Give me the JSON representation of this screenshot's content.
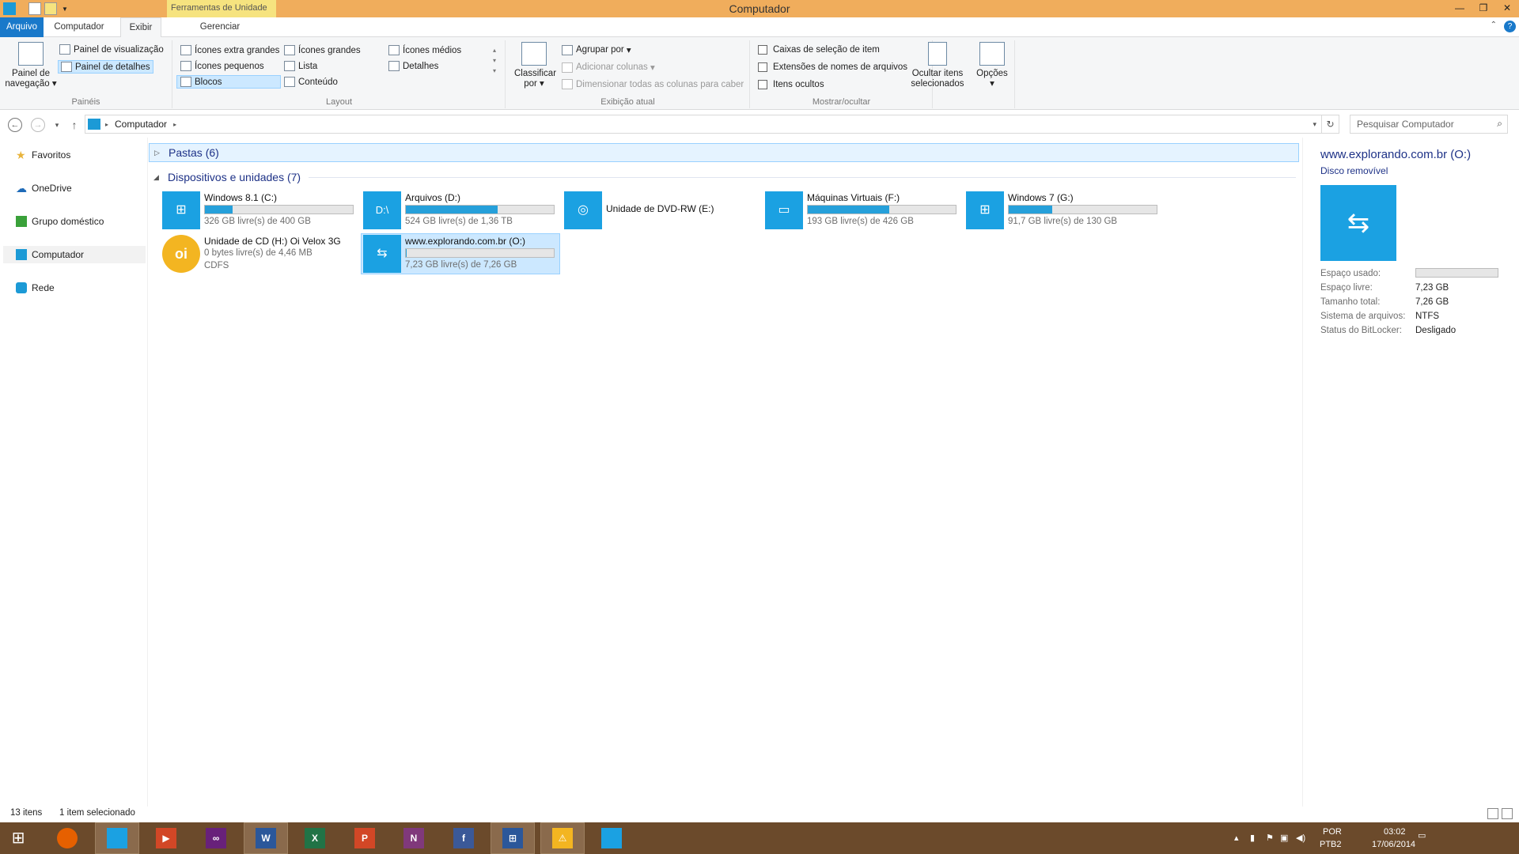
{
  "window": {
    "title": "Computador",
    "contextual_tab": "Ferramentas de Unidade"
  },
  "tabs": {
    "file": "Arquivo",
    "computer": "Computador",
    "view": "Exibir",
    "manage": "Gerenciar"
  },
  "ribbon": {
    "panes": {
      "nav_pane": "Painel de navegação",
      "preview_pane": "Painel de visualização",
      "details_pane": "Painel de detalhes",
      "label": "Painéis"
    },
    "layout": {
      "extra_large": "Ícones extra grandes",
      "large": "Ícones grandes",
      "medium": "Ícones médios",
      "small": "Ícones pequenos",
      "list": "Lista",
      "details": "Detalhes",
      "tiles": "Blocos",
      "content": "Conteúdo",
      "label": "Layout"
    },
    "current_view": {
      "sort_by": "Classificar por",
      "group_by": "Agrupar por",
      "add_columns": "Adicionar colunas",
      "size_columns": "Dimensionar todas as colunas para caber",
      "label": "Exibição atual"
    },
    "show_hide": {
      "item_checkboxes": "Caixas de seleção de item",
      "file_extensions": "Extensões de nomes de arquivos",
      "hidden_items": "Itens ocultos",
      "hide_selected": "Ocultar itens selecionados",
      "label": "Mostrar/ocultar"
    },
    "options": "Opções"
  },
  "address": {
    "path": "Computador",
    "search_placeholder": "Pesquisar Computador"
  },
  "nav": [
    {
      "label": "Favoritos"
    },
    {
      "label": "OneDrive"
    },
    {
      "label": "Grupo doméstico"
    },
    {
      "label": "Computador"
    },
    {
      "label": "Rede"
    }
  ],
  "groups": {
    "folders": "Pastas (6)",
    "devices": "Dispositivos e unidades (7)"
  },
  "drives": [
    {
      "name": "Windows 8.1 (C:)",
      "free": "326 GB livre(s) de 400 GB",
      "used_fraction": 0.185
    },
    {
      "name": "Arquivos (D:)",
      "free": "524 GB livre(s) de 1,36 TB",
      "used_fraction": 0.62
    },
    {
      "name": "Unidade de DVD-RW (E:)"
    },
    {
      "name": "Máquinas Virtuais (F:)",
      "free": "193 GB livre(s) de 426 GB",
      "used_fraction": 0.55
    },
    {
      "name": "Windows 7 (G:)",
      "free": "91,7 GB livre(s) de 130 GB",
      "used_fraction": 0.295
    },
    {
      "name": "Unidade de CD (H:) Oi Velox 3G",
      "free": "0 bytes livre(s) de 4,46 MB",
      "fs": "CDFS"
    },
    {
      "name": "www.explorando.com.br (O:)",
      "free": "7,23 GB livre(s) de 7,26 GB",
      "used_fraction": 0.004
    }
  ],
  "details_pane": {
    "title": "www.explorando.com.br (O:)",
    "type": "Disco removível",
    "used_label": "Espaço usado:",
    "free_label": "Espaço livre:",
    "free_value": "7,23 GB",
    "total_label": "Tamanho total:",
    "total_value": "7,26 GB",
    "fs_label": "Sistema de arquivos:",
    "fs_value": "NTFS",
    "bitlocker_label": "Status do BitLocker:",
    "bitlocker_value": "Desligado"
  },
  "status": {
    "items": "13 itens",
    "selected": "1 item selecionado"
  },
  "taskbar": {
    "lang": "POR",
    "layout": "PTB2",
    "time": "03:02",
    "date": "17/06/2014"
  },
  "colors": {
    "accent": "#1979ca",
    "tile": "#1ba1e2",
    "titlebar": "#f0ad5c",
    "taskbar": "#6b4a2b"
  }
}
